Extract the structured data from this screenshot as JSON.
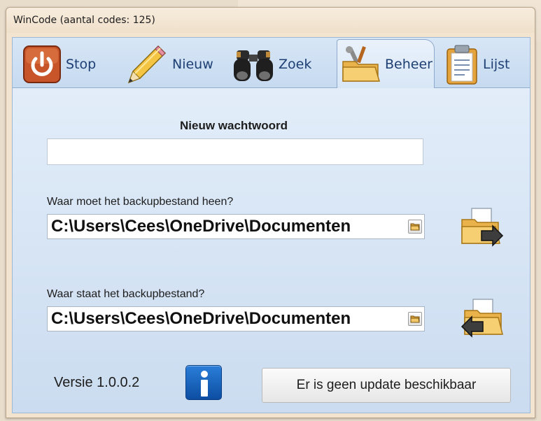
{
  "window": {
    "title": "WinCode (aantal codes: 125)"
  },
  "tabs": [
    {
      "label": "Stop",
      "icon": "power-icon"
    },
    {
      "label": "Nieuw",
      "icon": "pencil-icon"
    },
    {
      "label": "Zoek",
      "icon": "binoculars-icon"
    },
    {
      "label": "Beheer",
      "icon": "folder-tools-icon",
      "active": true
    },
    {
      "label": "Lijst",
      "icon": "clipboard-icon"
    }
  ],
  "beheer": {
    "new_password_heading": "Nieuw wachtwoord",
    "new_password_value": "",
    "backup_target_label": "Waar moet het backupbestand heen?",
    "backup_target_path": "C:\\Users\\Cees\\OneDrive\\Documenten",
    "backup_source_label": "Waar staat het backupbestand?",
    "backup_source_path": "C:\\Users\\Cees\\OneDrive\\Documenten",
    "version_text": "Versie 1.0.0.2",
    "update_button_label": "Er is geen update beschikbaar"
  },
  "colors": {
    "panel_blue": "#cfe0f3",
    "tab_text": "#1d3f73",
    "info_blue": "#1565c0"
  }
}
